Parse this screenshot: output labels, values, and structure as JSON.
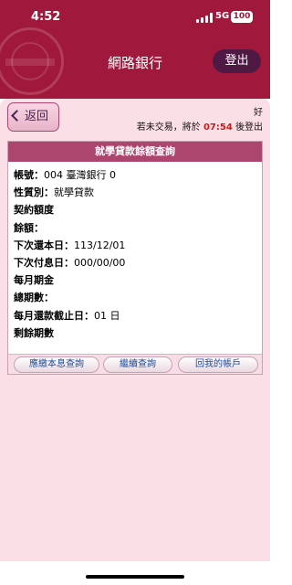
{
  "status_bar": {
    "time": "4:52",
    "network": "5G",
    "battery": "100"
  },
  "header": {
    "title": "網路銀行",
    "logout_label": "登出"
  },
  "nav": {
    "back_label": "返回"
  },
  "greeting": {
    "text": "好"
  },
  "session": {
    "prefix": "若未交易，將於",
    "countdown": "07:54",
    "suffix": "後登出"
  },
  "card": {
    "title": "就學貸款餘額查詢",
    "rows": [
      {
        "label": "帳號：",
        "value": "004 臺灣銀行 0"
      },
      {
        "label": "性質別：",
        "value": "就學貸款"
      },
      {
        "label": "契約額度",
        "value": ""
      },
      {
        "label": "餘額：",
        "value": ""
      },
      {
        "label": "下次還本日：",
        "value": "113/12/01"
      },
      {
        "label": "下次付息日：",
        "value": "000/00/00"
      },
      {
        "label": "每月期金",
        "value": ""
      },
      {
        "label": "總期數：",
        "value": ""
      },
      {
        "label": "每月還款截止日：",
        "value": "01 日"
      },
      {
        "label": "剩餘期數",
        "value": ""
      }
    ],
    "buttons": {
      "interest_query": "應繳本息查詢",
      "continue_query": "繼續查詢",
      "my_accounts": "回我的帳戶"
    }
  }
}
